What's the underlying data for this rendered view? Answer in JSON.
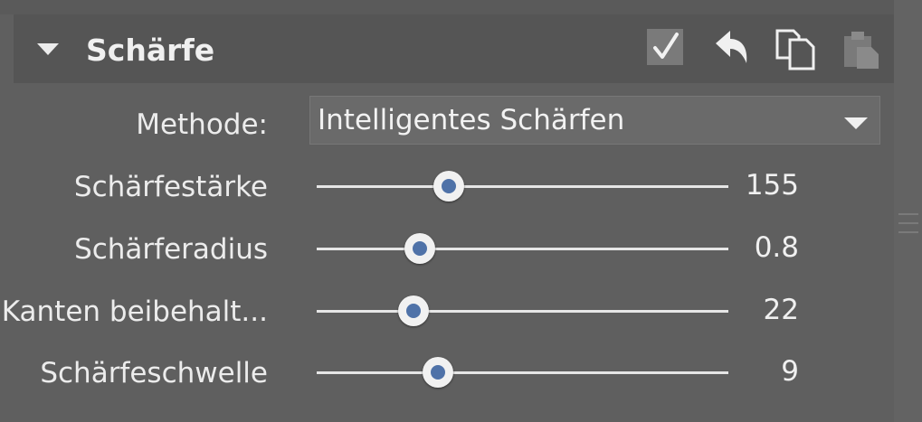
{
  "section": {
    "title": "Schärfe",
    "collapse_icon": "triangle-down-icon",
    "enabled": true,
    "header_icons": [
      "check-icon",
      "undo-icon",
      "copy-icon",
      "paste-icon"
    ]
  },
  "method": {
    "label": "Methode:",
    "value": "Intelligentes Schärfen"
  },
  "sliders": [
    {
      "label": "Schärfestärke",
      "value": "155",
      "fraction": 0.32
    },
    {
      "label": "Schärferadius",
      "value": "0.8",
      "fraction": 0.25
    },
    {
      "label": "Kanten beibehalt...",
      "value": "22",
      "fraction": 0.235
    },
    {
      "label": "Schärfeschwelle",
      "value": "9",
      "fraction": 0.295
    }
  ],
  "colors": {
    "thumb_center": "#4f72a8",
    "panel_bg": "#5f5f5f",
    "header_bg": "#555555"
  }
}
